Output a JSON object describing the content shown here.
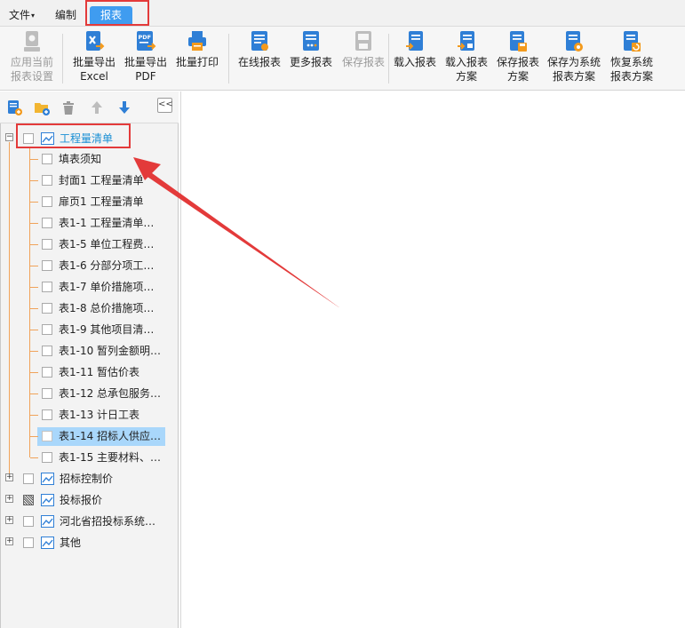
{
  "menubar": {
    "file_label": "文件",
    "edit_label": "编制",
    "report_label": "报表"
  },
  "ribbon": {
    "buttons": [
      {
        "line1": "应用当前",
        "line2": "报表设置",
        "icon": "apply-settings-icon",
        "enabled": false
      },
      {
        "line1": "批量导出",
        "line2": "Excel",
        "icon": "excel-export-icon",
        "enabled": true
      },
      {
        "line1": "批量导出",
        "line2": "PDF",
        "icon": "pdf-export-icon",
        "enabled": true
      },
      {
        "line1": "批量打印",
        "line2": "",
        "icon": "print-icon",
        "enabled": true
      },
      {
        "line1": "在线报表",
        "line2": "",
        "icon": "online-report-icon",
        "enabled": true
      },
      {
        "line1": "更多报表",
        "line2": "",
        "icon": "more-reports-icon",
        "enabled": true
      },
      {
        "line1": "保存报表",
        "line2": "",
        "icon": "save-report-icon",
        "enabled": false
      },
      {
        "line1": "载入报表",
        "line2": "",
        "icon": "load-report-icon",
        "enabled": true
      },
      {
        "line1": "载入报表",
        "line2": "方案",
        "icon": "load-scheme-icon",
        "enabled": true
      },
      {
        "line1": "保存报表",
        "line2": "方案",
        "icon": "save-scheme-icon",
        "enabled": true
      },
      {
        "line1": "保存为系统",
        "line2": "报表方案",
        "icon": "save-system-scheme-icon",
        "enabled": true
      },
      {
        "line1": "恢复系统",
        "line2": "报表方案",
        "icon": "restore-system-scheme-icon",
        "enabled": true
      }
    ]
  },
  "left_toolbar": {
    "collapse_label": "<<"
  },
  "tree": {
    "root": {
      "label": "工程量清单",
      "expanded": true
    },
    "children": [
      {
        "label": "填表须知"
      },
      {
        "label": "封面1 工程量清单"
      },
      {
        "label": "扉页1 工程量清单"
      },
      {
        "label": "表1-1 工程量清单…"
      },
      {
        "label": "表1-5 单位工程费…"
      },
      {
        "label": "表1-6 分部分项工…"
      },
      {
        "label": "表1-7 单价措施项…"
      },
      {
        "label": "表1-8 总价措施项…"
      },
      {
        "label": "表1-9 其他项目清…"
      },
      {
        "label": "表1-10 暂列金额明…"
      },
      {
        "label": "表1-11 暂估价表"
      },
      {
        "label": "表1-12 总承包服务…"
      },
      {
        "label": "表1-13 计日工表"
      },
      {
        "label": "表1-14 招标人供应…",
        "selected": true
      },
      {
        "label": "表1-15 主要材料、…"
      }
    ],
    "siblings": [
      {
        "label": "招标控制价",
        "state": "unchecked"
      },
      {
        "label": "投标报价",
        "state": "partial"
      },
      {
        "label": "河北省招投标系统…",
        "state": "unchecked"
      },
      {
        "label": "其他",
        "state": "unchecked"
      }
    ]
  },
  "colors": {
    "accent": "#3f9cf0",
    "annotation_red": "#e33a3a",
    "selection": "#a9d7fb",
    "tree_guide": "#f0a35a"
  }
}
